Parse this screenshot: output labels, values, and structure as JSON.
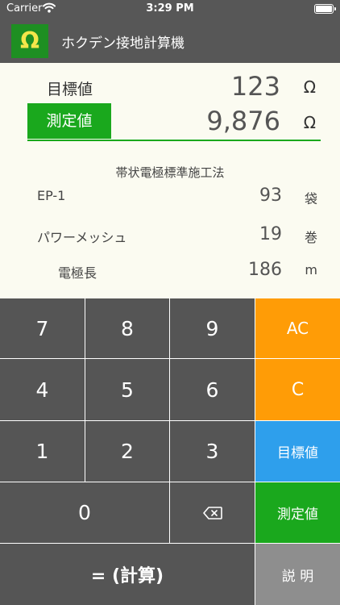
{
  "status_bar": {
    "carrier": "Carrier",
    "time": "3:29 PM"
  },
  "app": {
    "icon_symbol": "Ω",
    "title": "ホクデン接地計算機"
  },
  "display": {
    "target_label": "目標値",
    "target_value": "123",
    "target_unit": "Ω",
    "measured_label": "測定値",
    "measured_value": "9,876",
    "measured_unit": "Ω",
    "method_title": "帯状電極標準施工法",
    "results": [
      {
        "label": "EP-1",
        "value": "93",
        "unit": "袋"
      },
      {
        "label": "パワーメッシュ",
        "value": "19",
        "unit": "巻"
      },
      {
        "label": "電極長",
        "value": "186",
        "unit": "m"
      }
    ]
  },
  "keypad": {
    "k7": "7",
    "k8": "8",
    "k9": "9",
    "k4": "4",
    "k5": "5",
    "k6": "6",
    "k1": "1",
    "k2": "2",
    "k3": "3",
    "k0": "0",
    "ac": "AC",
    "c": "C",
    "target": "目標値",
    "measured": "測定値",
    "equals": "= (計算)",
    "help": "説 明"
  },
  "colors": {
    "accent_green": "#1aa81d",
    "accent_orange": "#ff9c06",
    "accent_blue": "#2e9fec",
    "key_dark": "#555555",
    "key_gray": "#8e8e8e",
    "display_bg": "#fbfbf1"
  }
}
